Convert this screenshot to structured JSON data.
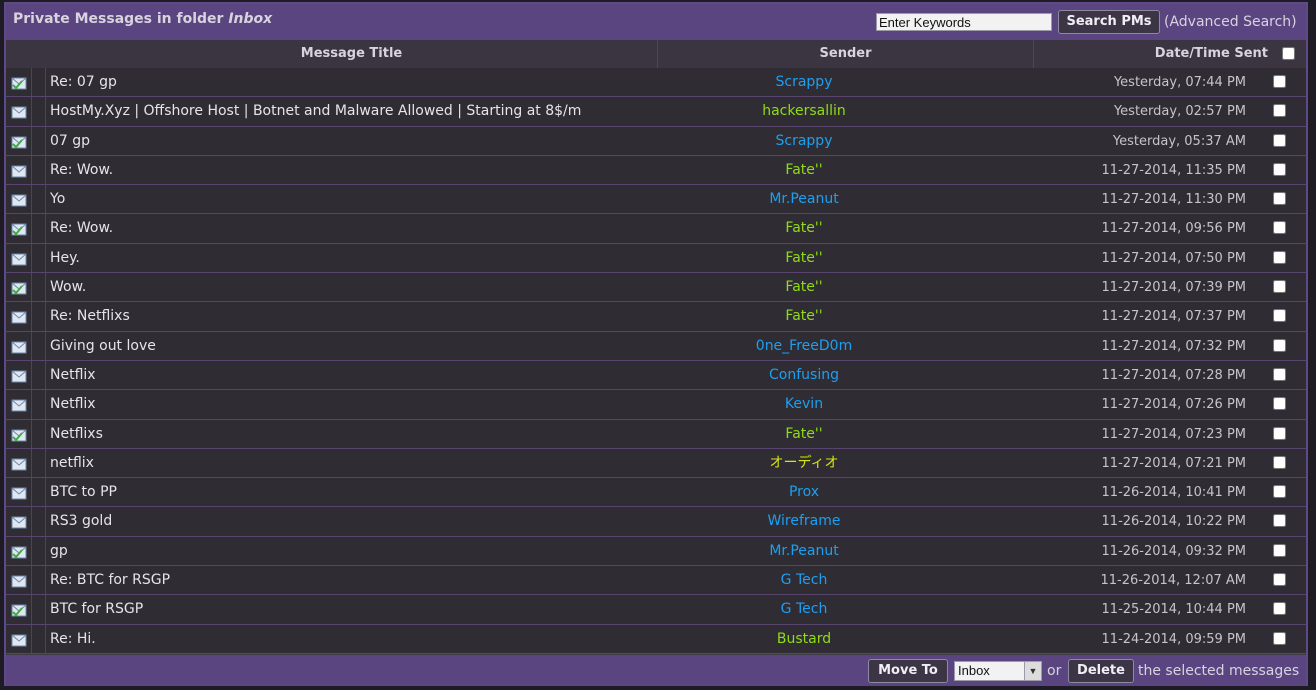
{
  "header": {
    "folder_prefix": "Private Messages in folder",
    "folder_name": "Inbox",
    "search_placeholder": "Enter Keywords",
    "search_button": "Search PMs",
    "advanced_search": "(Advanced Search)"
  },
  "columns": {
    "title": "Message Title",
    "sender": "Sender",
    "date": "Date/Time Sent"
  },
  "colors": {
    "sender_blue": "#1e9ff0",
    "sender_green": "#8fdc17",
    "sender_yellow": "#d6e514"
  },
  "messages": [
    {
      "icon": "replied-envelope-icon",
      "title": "Re: 07 gp",
      "sender": "Scrappy",
      "color": "#1e9ff0",
      "date": "Yesterday, 07:44 PM"
    },
    {
      "icon": "envelope-icon",
      "title": "HostMy.Xyz | Offshore Host | Botnet and Malware Allowed | Starting at 8$/m",
      "sender": "hackersallin",
      "color": "#8fdc17",
      "date": "Yesterday, 02:57 PM"
    },
    {
      "icon": "replied-envelope-icon",
      "title": "07 gp",
      "sender": "Scrappy",
      "color": "#1e9ff0",
      "date": "Yesterday, 05:37 AM"
    },
    {
      "icon": "envelope-icon",
      "title": "Re: Wow.",
      "sender": "Fate''",
      "color": "#8fdc17",
      "date": "11-27-2014, 11:35 PM"
    },
    {
      "icon": "envelope-icon",
      "title": "Yo",
      "sender": "Mr.Peanut",
      "color": "#1e9ff0",
      "date": "11-27-2014, 11:30 PM"
    },
    {
      "icon": "replied-envelope-icon",
      "title": "Re: Wow.",
      "sender": "Fate''",
      "color": "#8fdc17",
      "date": "11-27-2014, 09:56 PM"
    },
    {
      "icon": "envelope-icon",
      "title": "Hey.",
      "sender": "Fate''",
      "color": "#8fdc17",
      "date": "11-27-2014, 07:50 PM"
    },
    {
      "icon": "replied-envelope-icon",
      "title": "Wow.",
      "sender": "Fate''",
      "color": "#8fdc17",
      "date": "11-27-2014, 07:39 PM"
    },
    {
      "icon": "envelope-icon",
      "title": "Re: Netflixs",
      "sender": "Fate''",
      "color": "#8fdc17",
      "date": "11-27-2014, 07:37 PM"
    },
    {
      "icon": "envelope-icon",
      "title": "Giving out love",
      "sender": "0ne_FreeD0m",
      "color": "#1e9ff0",
      "date": "11-27-2014, 07:32 PM"
    },
    {
      "icon": "envelope-icon",
      "title": "Netflix",
      "sender": "Confusing",
      "color": "#1e9ff0",
      "date": "11-27-2014, 07:28 PM"
    },
    {
      "icon": "envelope-icon",
      "title": "Netflix",
      "sender": "Kevin",
      "color": "#1e9ff0",
      "date": "11-27-2014, 07:26 PM"
    },
    {
      "icon": "replied-envelope-icon",
      "title": "Netflixs",
      "sender": "Fate''",
      "color": "#8fdc17",
      "date": "11-27-2014, 07:23 PM"
    },
    {
      "icon": "envelope-icon",
      "title": "netflix",
      "sender": "オーディオ",
      "color": "#d6e514",
      "date": "11-27-2014, 07:21 PM"
    },
    {
      "icon": "envelope-icon",
      "title": "BTC to PP",
      "sender": "Prox",
      "color": "#1e9ff0",
      "date": "11-26-2014, 10:41 PM"
    },
    {
      "icon": "envelope-icon",
      "title": "RS3 gold",
      "sender": "Wireframe",
      "color": "#1e9ff0",
      "date": "11-26-2014, 10:22 PM"
    },
    {
      "icon": "replied-envelope-icon",
      "title": "gp",
      "sender": "Mr.Peanut",
      "color": "#1e9ff0",
      "date": "11-26-2014, 09:32 PM"
    },
    {
      "icon": "envelope-icon",
      "title": "Re: BTC for RSGP",
      "sender": "G Tech",
      "color": "#1e9ff0",
      "date": "11-26-2014, 12:07 AM"
    },
    {
      "icon": "replied-envelope-icon",
      "title": "BTC for RSGP",
      "sender": "G Tech",
      "color": "#1e9ff0",
      "date": "11-25-2014, 10:44 PM"
    },
    {
      "icon": "envelope-icon",
      "title": "Re: Hi.",
      "sender": "Bustard",
      "color": "#8fdc17",
      "date": "11-24-2014, 09:59 PM"
    }
  ],
  "footer": {
    "move_button": "Move To",
    "folder_select_value": "Inbox",
    "or_text": "or",
    "delete_button": "Delete",
    "selected_text": "the selected messages"
  }
}
